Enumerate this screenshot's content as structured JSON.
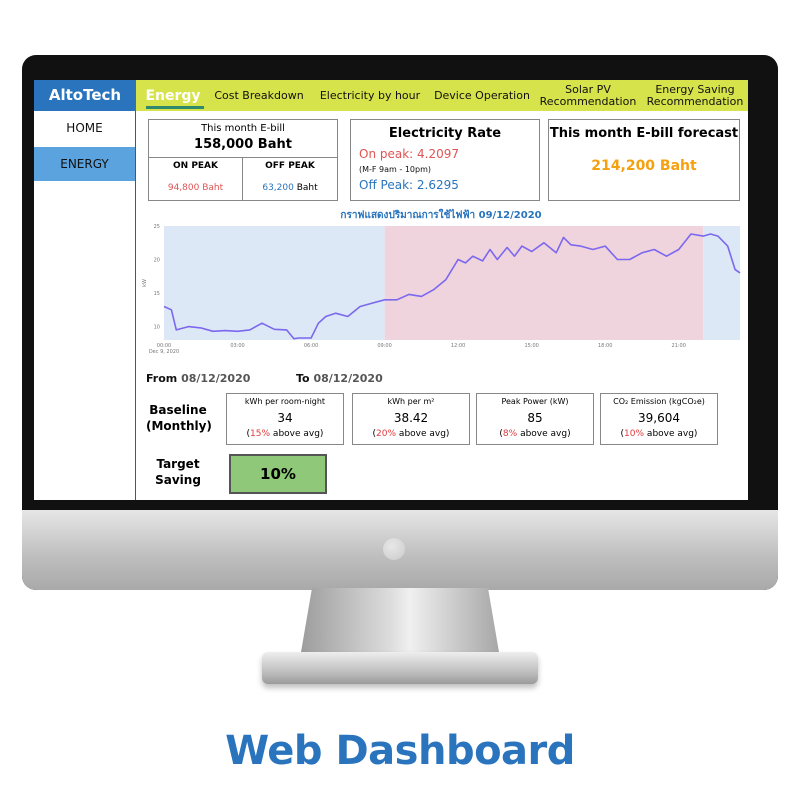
{
  "caption": "Web Dashboard",
  "app": {
    "logo": "AltoTech"
  },
  "tabs": [
    {
      "label": "Energy",
      "active": true
    },
    {
      "label": "Cost Breakdown"
    },
    {
      "label": "Electricity by hour"
    },
    {
      "label": "Device Operation"
    },
    {
      "label": "Solar PV Recommendation"
    },
    {
      "label": "Energy Saving Recommendation"
    }
  ],
  "sidebar": {
    "items": [
      {
        "label": "HOME"
      },
      {
        "label": "ENERGY",
        "active": true
      }
    ]
  },
  "ebill": {
    "title": "This month E-bill",
    "value": "158,000  Baht",
    "on_peak_label": "ON PEAK",
    "on_peak_value": "94,800 Baht",
    "off_peak_label": "OFF PEAK",
    "off_peak_number": "63,200",
    "off_peak_unit": "Baht"
  },
  "rate": {
    "title": "Electricity Rate",
    "on_peak": "On peak: 4.2097",
    "on_peak_time": "(M-F 9am - 10pm)",
    "off_peak": "Off Peak:  2.6295"
  },
  "forecast": {
    "title": "This month E-bill forecast",
    "value": "214,200 Baht"
  },
  "chart_title": "กราฟแสดงปริมาณการใช้ไฟฟ้า 09/12/2020",
  "chart_data": {
    "type": "line",
    "title": "กราฟแสดงปริมาณการใช้ไฟฟ้า 09/12/2020",
    "ylabel": "kW",
    "ylim": [
      8,
      25
    ],
    "xlim": [
      0,
      23.5
    ],
    "x_tick_labels": [
      "00:00\nDec 9, 2020",
      "03:00",
      "06:00",
      "09:00",
      "12:00",
      "15:00",
      "18:00",
      "21:00"
    ],
    "x_ticks": [
      0,
      3,
      6,
      9,
      12,
      15,
      18,
      21
    ],
    "y_ticks": [
      10,
      15,
      20,
      25
    ],
    "on_peak_band": [
      9,
      22
    ],
    "colors": {
      "line": "#7b68ee",
      "offpeak_bg": "#dde8f6",
      "onpeak_bg": "#efd4de"
    },
    "x": [
      0,
      0.3,
      0.5,
      1,
      1.5,
      2,
      2.5,
      3,
      3.5,
      4,
      4.5,
      5,
      5.3,
      5.5,
      6,
      6.3,
      6.6,
      7,
      7.5,
      8,
      8.5,
      9,
      9.5,
      10,
      10.5,
      11,
      11.5,
      12,
      12.3,
      12.6,
      13,
      13.3,
      13.6,
      14,
      14.3,
      14.6,
      15,
      15.5,
      16,
      16.3,
      16.6,
      17,
      17.5,
      18,
      18.5,
      19,
      19.5,
      20,
      20.5,
      21,
      21.5,
      22,
      22.3,
      22.6,
      23,
      23.3,
      23.5
    ],
    "y": [
      13,
      12.5,
      9.5,
      10,
      9.8,
      9.3,
      9.4,
      9.3,
      9.5,
      10.5,
      9.6,
      9.5,
      8.2,
      8.3,
      8.3,
      10.5,
      11.5,
      12,
      11.5,
      13,
      13.5,
      14,
      14,
      14.8,
      14.5,
      15.5,
      17,
      20,
      19.5,
      20.5,
      19.8,
      21.5,
      20,
      21.8,
      20.5,
      22,
      21.2,
      22.5,
      21,
      23.3,
      22.2,
      22,
      21.5,
      22,
      20,
      20,
      21,
      21.5,
      20.5,
      21.5,
      23.8,
      23.5,
      23.8,
      23.5,
      22,
      18.5,
      18
    ]
  },
  "date_range": {
    "from_label": "From",
    "from": "08/12/2020",
    "to_label": "To",
    "to": "08/12/2020"
  },
  "baseline": {
    "label_line1": "Baseline",
    "label_line2": "(Monthly)",
    "metrics": [
      {
        "label": "kWh per room-night",
        "value": "34",
        "pct": "15%",
        "suffix": " above avg)"
      },
      {
        "label": "kWh per m²",
        "value": "38.42",
        "pct": "20%",
        "suffix": " above avg)"
      },
      {
        "label": "Peak Power (kW)",
        "value": "85",
        "pct": "8%",
        "suffix": " above avg)"
      },
      {
        "label": "CO₂ Emission (kgCO₂e)",
        "value": "39,604",
        "pct": "10%",
        "suffix": " above avg)"
      }
    ]
  },
  "target": {
    "label_line1": "Target",
    "label_line2": "Saving",
    "value": "10%"
  }
}
